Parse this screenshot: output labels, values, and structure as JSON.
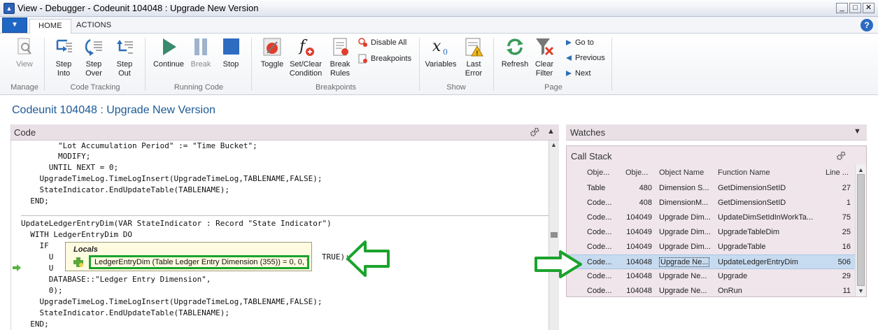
{
  "window": {
    "title": "View - Debugger - Codeunit 104048 : Upgrade New Version",
    "controls": [
      "_",
      "□",
      "✕"
    ]
  },
  "ribbon": {
    "tabs": [
      {
        "label": "HOME"
      },
      {
        "label": "ACTIONS"
      }
    ],
    "help": "?",
    "buttons": {
      "view": "View",
      "step_into": [
        "Step",
        "Into"
      ],
      "step_over": [
        "Step",
        "Over"
      ],
      "step_out": [
        "Step",
        "Out"
      ],
      "continue": "Continue",
      "break": "Break",
      "stop": "Stop",
      "toggle": "Toggle",
      "set_clear_condition": [
        "Set/Clear",
        "Condition"
      ],
      "break_rules": [
        "Break",
        "Rules"
      ],
      "disable_all": "Disable All",
      "breakpoints": "Breakpoints",
      "variables": "Variables",
      "last_error": [
        "Last",
        "Error"
      ],
      "refresh": "Refresh",
      "clear_filter": [
        "Clear",
        "Filter"
      ],
      "go_to": "Go to",
      "previous": "Previous",
      "next": "Next"
    },
    "groups": {
      "manage": "Manage",
      "code_tracking": "Code Tracking",
      "running_code": "Running Code",
      "breakpoints": "Breakpoints",
      "show": "Show",
      "page": "Page"
    }
  },
  "page_title": "Codeunit 104048 : Upgrade New Version",
  "code_panel": {
    "header": "Code",
    "lines": [
      "        \"Lot Accumulation Period\" := \"Time Bucket\";",
      "        MODIFY;",
      "      UNTIL NEXT = 0;",
      "    UpgradeTimeLog.TimeLogInsert(UpgradeTimeLog,TABLENAME,FALSE);",
      "    StateIndicator.EndUpdateTable(TABLENAME);",
      "  END;",
      "",
      "UpdateLedgerEntryDim(VAR StateIndicator : Record \"State Indicator\")",
      "  WITH LedgerEntryDim DO",
      "    IF",
      "      U",
      "      U",
      "      DATABASE::\"Ledger Entry Dimension\",",
      "      0);",
      "    UpgradeTimeLog.TimeLogInsert(UpgradeTimeLog,TABLENAME,FALSE);",
      "    StateIndicator.EndUpdateTable(TABLENAME);",
      "  END;"
    ],
    "line_tail": "TRUE);"
  },
  "locals_popup": {
    "header": "Locals",
    "value": "LedgerEntryDim (Table Ledger Entry Dimension (355)) = 0, 0, ''"
  },
  "watches": {
    "header": "Watches"
  },
  "call_stack": {
    "header": "Call Stack",
    "columns": [
      "Obje...",
      "Obje...",
      "Object Name",
      "Function Name",
      "Line ..."
    ],
    "rows": [
      [
        "Table",
        "480",
        "Dimension S...",
        "GetDimensionSetID",
        "27"
      ],
      [
        "Code...",
        "408",
        "DimensionM...",
        "GetDimensionSetID",
        "1"
      ],
      [
        "Code...",
        "104049",
        "Upgrade Dim...",
        "UpdateDimSetIdInWorkTa...",
        "75"
      ],
      [
        "Code...",
        "104049",
        "Upgrade Dim...",
        "UpgradeTableDim",
        "25"
      ],
      [
        "Code...",
        "104049",
        "Upgrade Dim...",
        "UpgradeTable",
        "16"
      ],
      [
        "Code...",
        "104048",
        "Upgrade Ne...",
        "UpdateLedgerEntryDim",
        "506"
      ],
      [
        "Code...",
        "104048",
        "Upgrade Ne...",
        "Upgrade",
        "29"
      ],
      [
        "Code...",
        "104048",
        "Upgrade Ne...",
        "OnRun",
        "11"
      ]
    ],
    "selected_row": 5
  },
  "colors": {
    "accent_blue": "#1c5a96",
    "panel_header": "#e9e0e6",
    "callstack_bg": "#efe5eb",
    "highlight_green": "#1aa32c",
    "selected_row": "#c7dbf0"
  }
}
